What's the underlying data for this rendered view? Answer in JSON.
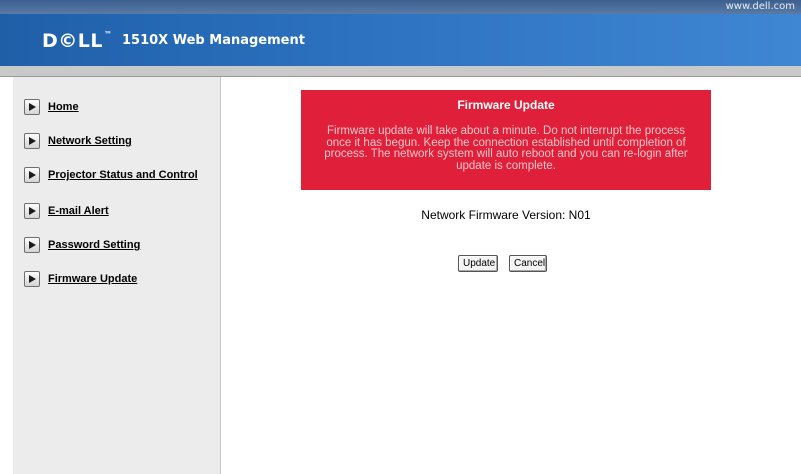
{
  "top_strip": {
    "url": "www.dell.com"
  },
  "header": {
    "logo": "D©LL",
    "logo_tm": "™",
    "title": "1510X Web Management"
  },
  "sidebar": {
    "items": [
      {
        "label": "Home",
        "icon": "play-arrow-icon"
      },
      {
        "label": "Network Setting",
        "icon": "play-arrow-icon"
      },
      {
        "label": "Projector Status and Control",
        "icon": "play-arrow-icon"
      },
      {
        "label": "E-mail Alert",
        "icon": "play-arrow-icon"
      },
      {
        "label": "Password Setting",
        "icon": "play-arrow-icon"
      },
      {
        "label": "Firmware Update",
        "icon": "play-arrow-icon"
      }
    ]
  },
  "notice": {
    "title": "Firmware Update",
    "body": "Firmware update will take about a minute. Do not interrupt the process once it has begun. Keep the connection established until completion of process. The network system will auto reboot and you can re-login after update is complete.",
    "background_color": "#e0203a"
  },
  "version": {
    "text": "Network Firmware Version: N01"
  },
  "buttons": {
    "update": "Update",
    "cancel": "Cancel"
  }
}
